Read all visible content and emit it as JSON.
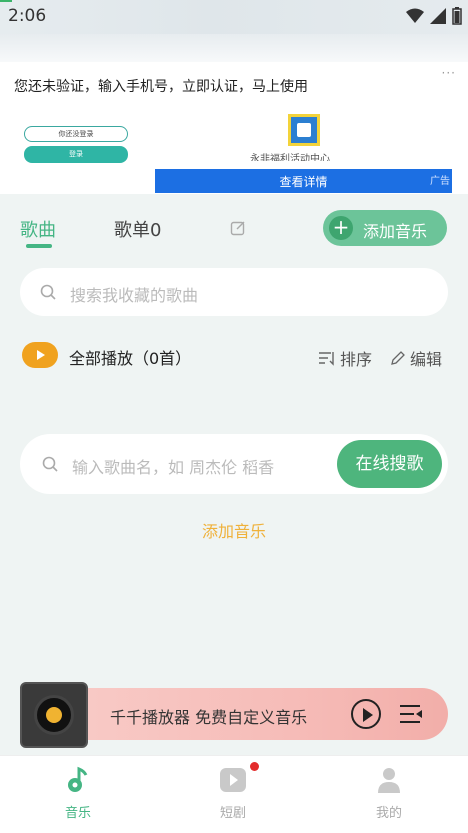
{
  "status_bar": {
    "time": "2:06"
  },
  "ad": {
    "message": "您还未验证，输入手机号，立即认证，马上使用",
    "more": "···",
    "login_text": "你还没登录",
    "login_button": "登录",
    "sub_text": "永非福利活动中心",
    "cta": "查看详情",
    "tag": "广告"
  },
  "tabs": {
    "songs": "歌曲",
    "playlists": "歌单0",
    "add_music": "添加音乐"
  },
  "search": {
    "placeholder": "搜索我收藏的歌曲"
  },
  "actions": {
    "play_all": "全部播放（0首）",
    "sort": "排序",
    "edit": "编辑"
  },
  "online": {
    "placeholder": "输入歌曲名，如 周杰伦 稻香",
    "button": "在线搜歌"
  },
  "add_music_link": "添加音乐",
  "player": {
    "title": "千千播放器 免费自定义音乐"
  },
  "bottom_nav": [
    {
      "label": "音乐",
      "color": "#45b584"
    },
    {
      "label": "短剧",
      "color": "#aaaaaa"
    },
    {
      "label": "我的",
      "color": "#aaaaaa"
    }
  ],
  "colors": {
    "accent": "#45b584",
    "orange": "#f0a21f",
    "link": "#efb13a",
    "ad_blue": "#1c6fe3"
  }
}
